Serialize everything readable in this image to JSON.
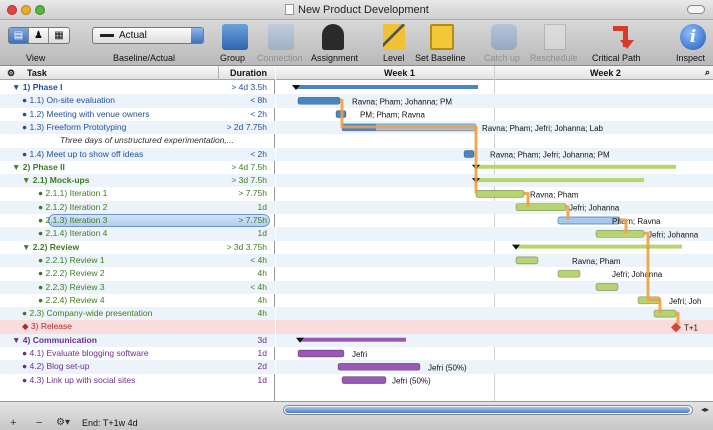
{
  "window": {
    "title": "New Product Development"
  },
  "toolbar": {
    "view_label": "View",
    "baseline_label": "Baseline/Actual",
    "baseline_value": "Actual",
    "group_label": "Group",
    "connection_label": "Connection",
    "assignment_label": "Assignment",
    "level_label": "Level",
    "set_baseline_label": "Set Baseline",
    "catch_up_label": "Catch up",
    "reschedule_label": "Reschedule",
    "critical_path_label": "Critical Path",
    "inspect_label": "Inspect"
  },
  "outline": {
    "task_header": "Task",
    "duration_header": "Duration",
    "rows": [
      {
        "name": "▼ 1)  Phase I",
        "dur": "> 4d 3.5h",
        "color": "blue",
        "bold": true
      },
      {
        "name": "● 1.1)  On-site evaluation",
        "dur": "< 8h",
        "color": "blue"
      },
      {
        "name": "● 1.2)  Meeting with venue owners",
        "dur": "< 2h",
        "color": "blue"
      },
      {
        "name": "● 1.3)  Freeform Prototyping",
        "dur": "> 2d 7.75h",
        "color": "blue"
      },
      {
        "name": "Three days of unstructured experimentation,...",
        "dur": "",
        "color": "note"
      },
      {
        "name": "● 1.4)  Meet up to show off ideas",
        "dur": "< 2h",
        "color": "blue"
      },
      {
        "name": "▼ 2)  Phase II",
        "dur": "> 4d 7.5h",
        "color": "green",
        "bold": true
      },
      {
        "name": "▼ 2.1)  Mock-ups",
        "dur": "> 3d 7.5h",
        "color": "green",
        "bold": true
      },
      {
        "name": "● 2.1.1)  Iteration 1",
        "dur": "> 7.75h",
        "color": "green"
      },
      {
        "name": "● 2.1.2)  Iteration 2",
        "dur": "1d",
        "color": "green"
      },
      {
        "name": "● 2.1.3)  Iteration 3",
        "dur": "> 7.75h",
        "color": "green",
        "selected": true
      },
      {
        "name": "● 2.1.4)  Iteration 4",
        "dur": "1d",
        "color": "green"
      },
      {
        "name": "▼ 2.2)  Review",
        "dur": "> 3d 3.75h",
        "color": "green",
        "bold": true
      },
      {
        "name": "● 2.2.1)  Review 1",
        "dur": "< 4h",
        "color": "green"
      },
      {
        "name": "● 2.2.2)  Review 2",
        "dur": "4h",
        "color": "green"
      },
      {
        "name": "● 2.2.3)  Review 3",
        "dur": "< 4h",
        "color": "green"
      },
      {
        "name": "● 2.2.4)  Review 4",
        "dur": "4h",
        "color": "green"
      },
      {
        "name": "● 2.3)  Company-wide presentation",
        "dur": "4h",
        "color": "green"
      },
      {
        "name": "◆ 3)  Release",
        "dur": "",
        "color": "red"
      },
      {
        "name": "▼ 4)  Communication",
        "dur": "3d",
        "color": "purple",
        "bold": true
      },
      {
        "name": "● 4.1)  Evaluate blogging software",
        "dur": "1d",
        "color": "purple"
      },
      {
        "name": "● 4.2)  Blog set-up",
        "dur": "2d",
        "color": "purple"
      },
      {
        "name": "● 4.3)  Link up with social sites",
        "dur": "1d",
        "color": "purple"
      }
    ]
  },
  "gantt": {
    "week1_label": "Week 1",
    "week2_label": "Week 2",
    "labels": {
      "r1": "Ravna; Pham; Johanna; PM",
      "r2": "PM; Pham; Ravna",
      "r3": "Ravna; Pham; Jefri; Johanna; Lab",
      "r5": "Ravna; Pham; Jefri; Johanna; PM",
      "r8": "Ravna; Pham",
      "r9": "Jefri; Johanna",
      "r10": "Pham; Ravna",
      "r11": "Jefri; Johanna",
      "r13": "Ravna; Pham",
      "r14": "Jefri; Johanna",
      "r16": "Jefri; Joh",
      "r18": "T+1",
      "r20": "Jefri",
      "r21": "Jefri (50%)",
      "r22": "Jefri (50%)"
    }
  },
  "colors": {
    "blue": "#4a86c6",
    "green": "#b7d56f",
    "purple": "#9a59b5",
    "critical": "#f0a040",
    "red": "#d8443a"
  },
  "footer": {
    "end_label": "End: T+1w 4d"
  }
}
